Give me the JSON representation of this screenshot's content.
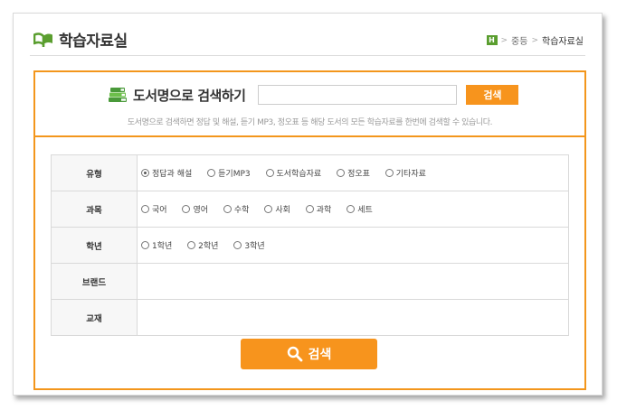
{
  "header": {
    "title": "학습자료실",
    "breadcrumb": {
      "home_icon": "H",
      "level1": "중등",
      "current": "학습자료실"
    },
    "separator": ">"
  },
  "search": {
    "label": "도서명으로 검색하기",
    "input_value": "",
    "button_label": "검색",
    "description": "도서명으로 검색하면 정답 및 해설, 듣기 MP3, 정오표 등 해당 도서의 모든 학습자료를 한번에 검색할 수 있습니다."
  },
  "filters": {
    "type": {
      "label": "유형",
      "options": [
        "정답과 해설",
        "듣기MP3",
        "도서학습자료",
        "정오표",
        "기타자료"
      ],
      "selected": 0
    },
    "subject": {
      "label": "과목",
      "options": [
        "국어",
        "영어",
        "수학",
        "사회",
        "과학",
        "세트"
      ]
    },
    "grade": {
      "label": "학년",
      "options": [
        "1학년",
        "2학년",
        "3학년"
      ]
    },
    "brand": {
      "label": "브랜드"
    },
    "textbook": {
      "label": "교재"
    }
  },
  "submit": {
    "label": "검색"
  },
  "colors": {
    "accent": "#f7941d",
    "border": "#f3961c",
    "logo_green": "#5a9e2f"
  }
}
